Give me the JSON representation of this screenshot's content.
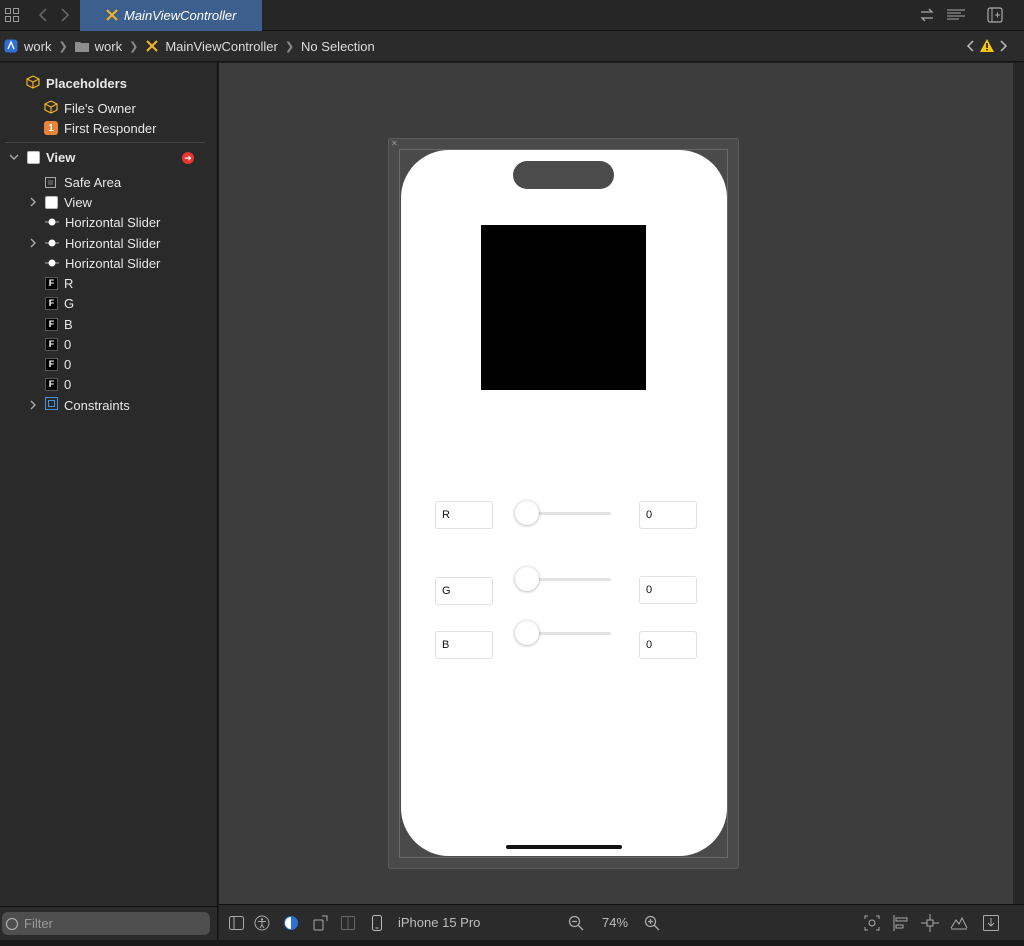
{
  "tabbar": {
    "active_tab": "MainViewController"
  },
  "breadcrumb": {
    "items": [
      "work",
      "work",
      "MainViewController",
      "No Selection"
    ]
  },
  "navigator": {
    "placeholders_header": "Placeholders",
    "files_owner": "File's Owner",
    "first_responder_badge": "1",
    "first_responder": "First Responder",
    "view_root": "View",
    "safe_area": "Safe Area",
    "view_child": "View",
    "slider1": "Horizontal Slider",
    "slider2": "Horizontal Slider",
    "slider3": "Horizontal Slider",
    "label_badge": "F",
    "label_r": "R",
    "label_g": "G",
    "label_b": "B",
    "label_v1": "0",
    "label_v2": "0",
    "label_v3": "0",
    "constraints": "Constraints"
  },
  "scene": {
    "color_preview": "#000000",
    "fields": {
      "r_label": "R",
      "g_label": "G",
      "b_label": "B",
      "r_value": "0",
      "g_value": "0",
      "b_value": "0"
    },
    "sliders": {
      "r": 0,
      "g": 0,
      "b": 0
    }
  },
  "filter": {
    "placeholder": "Filter"
  },
  "canvasbar": {
    "device": "iPhone 15 Pro",
    "zoom": "74%"
  },
  "colors": {
    "accent_tab": "#3d5f8e",
    "badge_orange": "#e8833a",
    "error_red": "#e33333",
    "warning_yellow": "#f5c518"
  }
}
